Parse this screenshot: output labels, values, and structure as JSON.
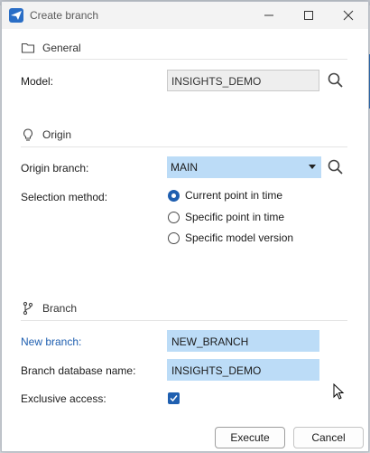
{
  "window": {
    "title": "Create branch",
    "accent_color": "#2a6ec6",
    "controls": [
      "minimize-icon",
      "maximize-icon",
      "close-icon"
    ]
  },
  "general": {
    "heading": "General",
    "icon": "folder-icon",
    "model_label": "Model:",
    "model_value": "INSIGHTS_DEMO"
  },
  "origin": {
    "heading": "Origin",
    "icon": "bulb-icon",
    "branch_label": "Origin branch:",
    "branch_value": "MAIN",
    "selection_label": "Selection method:",
    "options": [
      {
        "label": "Current point in time",
        "selected": true
      },
      {
        "label": "Specific point in time",
        "selected": false
      },
      {
        "label": "Specific model version",
        "selected": false
      }
    ]
  },
  "branch": {
    "heading": "Branch",
    "icon": "branch-icon",
    "new_branch_label": "New branch:",
    "new_branch_value": "NEW_BRANCH",
    "db_name_label": "Branch database name:",
    "db_name_value": "INSIGHTS_DEMO",
    "exclusive_label": "Exclusive access:",
    "exclusive_checked": true
  },
  "buttons": {
    "execute": "Execute",
    "cancel": "Cancel"
  }
}
